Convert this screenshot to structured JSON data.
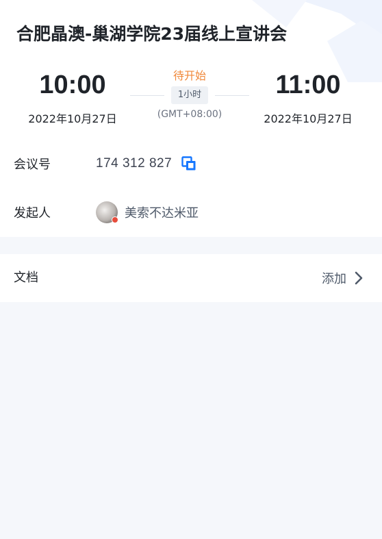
{
  "meeting": {
    "title": "合肥晶澳-巢湖学院23届线上宣讲会",
    "start_time": "10:00",
    "start_date": "2022年10月27日",
    "end_time": "11:00",
    "end_date": "2022年10月27日",
    "status": "待开始",
    "duration": "1小时",
    "timezone": "(GMT+08:00)"
  },
  "details": {
    "meeting_id_label": "会议号",
    "meeting_id": "174 312 827",
    "host_label": "发起人",
    "host_name": "美索不达米亚"
  },
  "documents": {
    "label": "文档",
    "add_label": "添加"
  },
  "colors": {
    "accent": "#1677ff",
    "status": "#f0883a",
    "text_primary": "#1f2329",
    "text_secondary": "#4e5969",
    "background": "#f5f7fb"
  },
  "icons": {
    "copy": "copy-icon",
    "chevron": "chevron-right-icon"
  }
}
